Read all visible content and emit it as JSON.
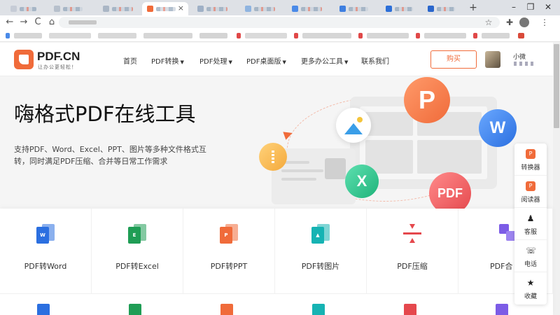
{
  "browser": {
    "tab_close_glyph": "×",
    "new_tab_glyph": "+",
    "window": {
      "minimize": "–",
      "maximize": "❐",
      "close": "✕"
    },
    "nav": {
      "back": "←",
      "forward": "→",
      "reload": "C",
      "home": "⌂"
    },
    "toolbar": {
      "star": "☆",
      "extensions": "✚",
      "menu": "⋮"
    }
  },
  "site": {
    "logo_name": "PDF.CN",
    "logo_slogan": "让办公更轻松！",
    "nav": [
      {
        "label": "首页",
        "caret": ""
      },
      {
        "label": "PDF转换",
        "caret": "▼"
      },
      {
        "label": "PDF处理",
        "caret": "▼"
      },
      {
        "label": "PDF桌面版",
        "caret": "▼"
      },
      {
        "label": "更多办公工具",
        "caret": "▼"
      },
      {
        "label": "联系我们",
        "caret": ""
      }
    ],
    "buy_label": "购买",
    "username": "小微"
  },
  "hero": {
    "title": "嗨格式PDF在线工具",
    "subtitle": "支持PDF、Word、Excel、PPT、图片等多种文件格式互转，同时满足PDF压缩、合并等日常工作需求",
    "bubbles": {
      "p": "P",
      "w": "W",
      "x": "X",
      "pdf": "PDF"
    }
  },
  "tools": [
    {
      "label": "PDF转Word",
      "glyph": "W",
      "color": "#2b6fe0"
    },
    {
      "label": "PDF转Excel",
      "glyph": "E",
      "color": "#1f9d55"
    },
    {
      "label": "PDF转PPT",
      "glyph": "P",
      "color": "#f06b3a"
    },
    {
      "label": "PDF转图片",
      "glyph": "▲",
      "color": "#16b3b3"
    },
    {
      "label": "PDF压缩",
      "glyph": "",
      "color": "#e5484d"
    },
    {
      "label": "PDF合",
      "glyph": "",
      "color": "#7c5ce6"
    }
  ],
  "side_panel": [
    {
      "label": "转换器",
      "icon": "P",
      "icon_name": "converter-icon"
    },
    {
      "label": "阅读器",
      "icon": "P",
      "icon_name": "reader-icon"
    },
    {
      "label": "客服",
      "icon": "♟",
      "icon_name": "support-icon"
    },
    {
      "label": "电话",
      "icon": "☏",
      "icon_name": "phone-icon"
    },
    {
      "label": "收藏",
      "icon": "★",
      "icon_name": "star-icon"
    }
  ],
  "colors": {
    "brand": "#f06b3a",
    "word": "#2b6fe0",
    "excel": "#1f9d55",
    "image": "#16b3b3",
    "compress": "#e5484d",
    "merge": "#7c5ce6"
  }
}
